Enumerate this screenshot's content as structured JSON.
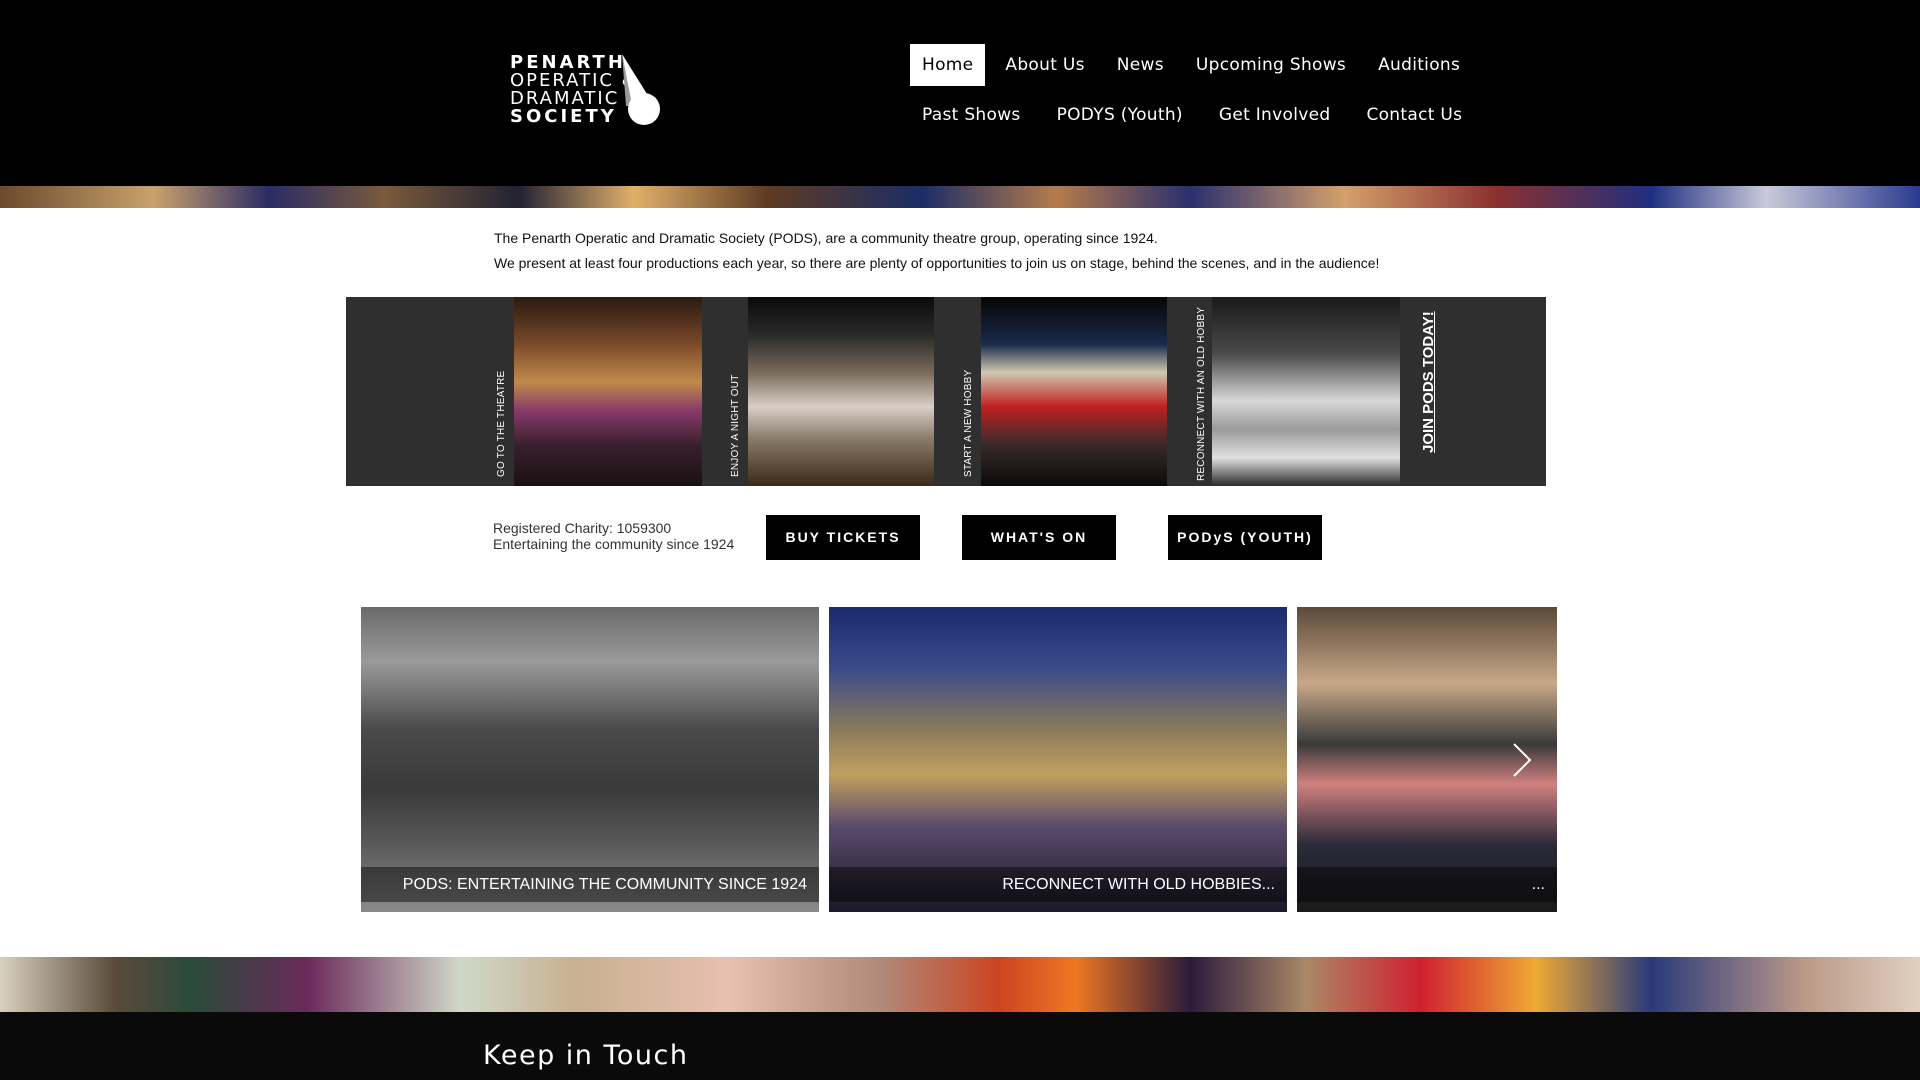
{
  "header": {
    "logo": {
      "lines": [
        "PENARTH",
        "OPERATIC &",
        "DRAMATIC",
        "SOCIETY"
      ]
    },
    "nav_row1": [
      {
        "label": "Home",
        "active": true
      },
      {
        "label": "About Us"
      },
      {
        "label": "News"
      },
      {
        "label": "Upcoming Shows"
      },
      {
        "label": "Auditions"
      }
    ],
    "nav_row2": [
      {
        "label": "Past Shows"
      },
      {
        "label": "PODYS (Youth)"
      },
      {
        "label": "Get Involved"
      },
      {
        "label": "Contact Us"
      }
    ]
  },
  "intro": {
    "line1": "The Penarth Operatic and Dramatic Society (PODS), are a community theatre group, operating since 1924.",
    "line2": "We present at least four productions each year, so there are plenty of opportunities to join us on stage, behind the scenes, and in the audience!"
  },
  "banner": {
    "panels": [
      {
        "label": "GO TO THE THEATRE"
      },
      {
        "label": "ENJOY A NIGHT OUT"
      },
      {
        "label": "START A NEW HOBBY"
      },
      {
        "label": "RECONNECT WITH AN OLD HOBBY"
      }
    ],
    "cta": "JOIN PODS TODAY!"
  },
  "charity": {
    "line1": "Registered Charity: 1059300",
    "line2": "Entertaining the community since 1924"
  },
  "buttons": {
    "buy_tickets": "BUY TICKETS",
    "whats_on": "WHAT'S ON",
    "podys": "PODyS (YOUTH)"
  },
  "gallery": {
    "slides": [
      {
        "caption": "PODS: ENTERTAINING THE COMMUNITY SINCE 1924"
      },
      {
        "caption": "RECONNECT WITH OLD HOBBIES..."
      },
      {
        "caption": "..."
      }
    ]
  },
  "footer": {
    "title": "Keep in Touch"
  },
  "colors": {
    "header_bg": "#000000",
    "banner_bg": "#2f2f2f",
    "button_bg": "#000000",
    "text": "#111111"
  },
  "icons": {
    "logo_mark": "spotlight-icon",
    "gallery_next": "chevron-right-icon"
  }
}
